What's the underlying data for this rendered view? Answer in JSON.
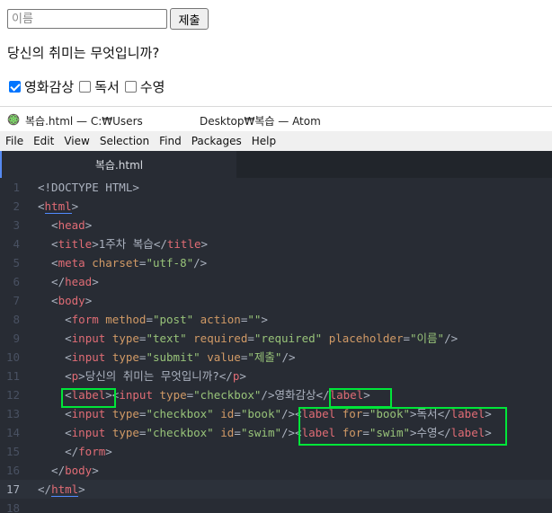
{
  "browser": {
    "name_placeholder": "이름",
    "submit_label": "제출",
    "question": "당신의 취미는 무엇입니까?",
    "checkboxes": [
      {
        "label": "영화감상",
        "checked": true
      },
      {
        "label": "독서",
        "checked": false
      },
      {
        "label": "수영",
        "checked": false
      }
    ]
  },
  "atom": {
    "title_left": "복습.html — C:₩Users",
    "title_right": "Desktop₩복습 — Atom",
    "menu": [
      "File",
      "Edit",
      "View",
      "Selection",
      "Find",
      "Packages",
      "Help"
    ],
    "tab_label": "복습.html",
    "current_line": 17,
    "lines": [
      {
        "n": "1",
        "tokens": [
          [
            "p",
            "<!DOCTYPE HTML>"
          ]
        ]
      },
      {
        "n": "2",
        "tokens": [
          [
            "p",
            "<"
          ],
          [
            "tu",
            "html"
          ],
          [
            "p",
            ">"
          ]
        ]
      },
      {
        "n": "3",
        "tokens": [
          [
            "p",
            "  <"
          ],
          [
            "t",
            "head"
          ],
          [
            "p",
            ">"
          ]
        ]
      },
      {
        "n": "4",
        "tokens": [
          [
            "p",
            "  <"
          ],
          [
            "t",
            "title"
          ],
          [
            "p",
            ">"
          ],
          [
            "tx",
            "1주차 복습"
          ],
          [
            "p",
            "</"
          ],
          [
            "t",
            "title"
          ],
          [
            "p",
            ">"
          ]
        ]
      },
      {
        "n": "5",
        "tokens": [
          [
            "p",
            "  <"
          ],
          [
            "t",
            "meta"
          ],
          [
            "p",
            " "
          ],
          [
            "a",
            "charset"
          ],
          [
            "p",
            "="
          ],
          [
            "s",
            "\"utf-8\""
          ],
          [
            "p",
            "/>"
          ]
        ]
      },
      {
        "n": "6",
        "tokens": [
          [
            "p",
            "  </"
          ],
          [
            "t",
            "head"
          ],
          [
            "p",
            ">"
          ]
        ]
      },
      {
        "n": "7",
        "tokens": [
          [
            "p",
            "  <"
          ],
          [
            "t",
            "body"
          ],
          [
            "p",
            ">"
          ]
        ]
      },
      {
        "n": "8",
        "tokens": [
          [
            "p",
            "    <"
          ],
          [
            "t",
            "form"
          ],
          [
            "p",
            " "
          ],
          [
            "a",
            "method"
          ],
          [
            "p",
            "="
          ],
          [
            "s",
            "\"post\""
          ],
          [
            "p",
            " "
          ],
          [
            "a",
            "action"
          ],
          [
            "p",
            "="
          ],
          [
            "s",
            "\"\""
          ],
          [
            "p",
            ">"
          ]
        ]
      },
      {
        "n": "9",
        "tokens": [
          [
            "p",
            "    <"
          ],
          [
            "t",
            "input"
          ],
          [
            "p",
            " "
          ],
          [
            "a",
            "type"
          ],
          [
            "p",
            "="
          ],
          [
            "s",
            "\"text\""
          ],
          [
            "p",
            " "
          ],
          [
            "a",
            "required"
          ],
          [
            "p",
            "="
          ],
          [
            "s",
            "\"required\""
          ],
          [
            "p",
            " "
          ],
          [
            "a",
            "placeholder"
          ],
          [
            "p",
            "="
          ],
          [
            "s",
            "\"이름\""
          ],
          [
            "p",
            "/>"
          ]
        ]
      },
      {
        "n": "10",
        "tokens": [
          [
            "p",
            "    <"
          ],
          [
            "t",
            "input"
          ],
          [
            "p",
            " "
          ],
          [
            "a",
            "type"
          ],
          [
            "p",
            "="
          ],
          [
            "s",
            "\"submit\""
          ],
          [
            "p",
            " "
          ],
          [
            "a",
            "value"
          ],
          [
            "p",
            "="
          ],
          [
            "s",
            "\"제출\""
          ],
          [
            "p",
            "/>"
          ]
        ]
      },
      {
        "n": "11",
        "tokens": [
          [
            "p",
            "    <"
          ],
          [
            "t",
            "p"
          ],
          [
            "p",
            ">"
          ],
          [
            "tx",
            "당신의 취미는 무엇입니까?"
          ],
          [
            "p",
            "</"
          ],
          [
            "t",
            "p"
          ],
          [
            "p",
            ">"
          ]
        ]
      },
      {
        "n": "12",
        "tokens": [
          [
            "p",
            "    <"
          ],
          [
            "t",
            "label"
          ],
          [
            "p",
            "><"
          ],
          [
            "t",
            "input"
          ],
          [
            "p",
            " "
          ],
          [
            "a",
            "type"
          ],
          [
            "p",
            "="
          ],
          [
            "s",
            "\"checkbox\""
          ],
          [
            "p",
            "/>"
          ],
          [
            "tx",
            "영화감상"
          ],
          [
            "p",
            "</"
          ],
          [
            "t",
            "label"
          ],
          [
            "p",
            ">"
          ]
        ]
      },
      {
        "n": "13",
        "tokens": [
          [
            "p",
            "    <"
          ],
          [
            "t",
            "input"
          ],
          [
            "p",
            " "
          ],
          [
            "a",
            "type"
          ],
          [
            "p",
            "="
          ],
          [
            "s",
            "\"checkbox\""
          ],
          [
            "p",
            " "
          ],
          [
            "a",
            "id"
          ],
          [
            "p",
            "="
          ],
          [
            "s",
            "\"book\""
          ],
          [
            "p",
            "/><"
          ],
          [
            "t",
            "label"
          ],
          [
            "p",
            " "
          ],
          [
            "a",
            "for"
          ],
          [
            "p",
            "="
          ],
          [
            "s",
            "\"book\""
          ],
          [
            "p",
            ">"
          ],
          [
            "tx",
            "독서"
          ],
          [
            "p",
            "</"
          ],
          [
            "t",
            "label"
          ],
          [
            "p",
            ">"
          ]
        ]
      },
      {
        "n": "14",
        "tokens": [
          [
            "p",
            "    <"
          ],
          [
            "t",
            "input"
          ],
          [
            "p",
            " "
          ],
          [
            "a",
            "type"
          ],
          [
            "p",
            "="
          ],
          [
            "s",
            "\"checkbox\""
          ],
          [
            "p",
            " "
          ],
          [
            "a",
            "id"
          ],
          [
            "p",
            "="
          ],
          [
            "s",
            "\"swim\""
          ],
          [
            "p",
            "/><"
          ],
          [
            "t",
            "label"
          ],
          [
            "p",
            " "
          ],
          [
            "a",
            "for"
          ],
          [
            "p",
            "="
          ],
          [
            "s",
            "\"swim\""
          ],
          [
            "p",
            ">"
          ],
          [
            "tx",
            "수영"
          ],
          [
            "p",
            "</"
          ],
          [
            "t",
            "label"
          ],
          [
            "p",
            ">"
          ]
        ]
      },
      {
        "n": "15",
        "tokens": [
          [
            "p",
            "    </"
          ],
          [
            "t",
            "form"
          ],
          [
            "p",
            ">"
          ]
        ]
      },
      {
        "n": "16",
        "tokens": [
          [
            "p",
            "  </"
          ],
          [
            "t",
            "body"
          ],
          [
            "p",
            ">"
          ]
        ]
      },
      {
        "n": "17",
        "tokens": [
          [
            "p",
            "</"
          ],
          [
            "tu",
            "html"
          ],
          [
            "p",
            ">"
          ]
        ]
      },
      {
        "n": "18",
        "tokens": []
      }
    ]
  },
  "colors": {
    "highlight_box": "#00e639",
    "editor_bg": "#282c34",
    "checkbox_checked": "#0075ff"
  }
}
